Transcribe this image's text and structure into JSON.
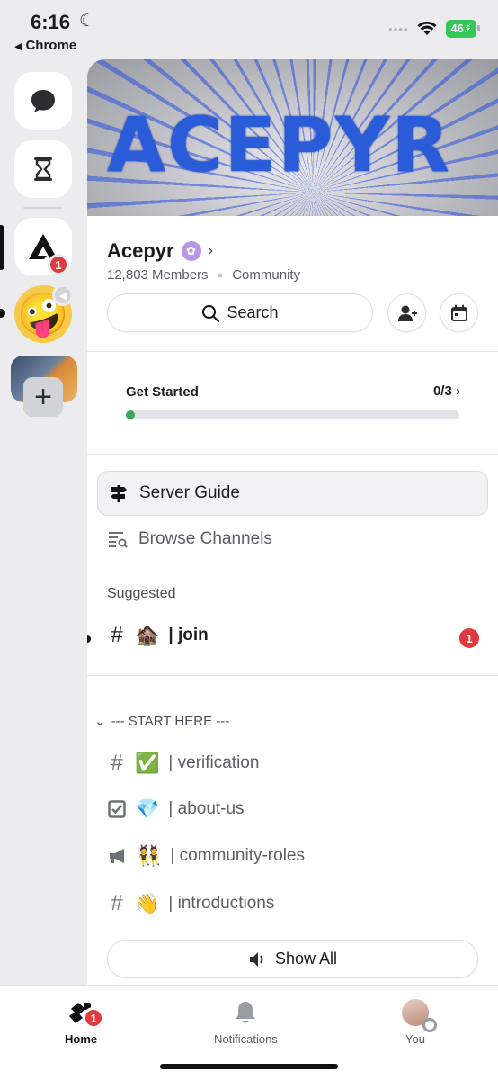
{
  "status": {
    "time": "6:16",
    "back_app": "Chrome",
    "battery": "46"
  },
  "rail": {
    "server_badge": "1"
  },
  "server": {
    "banner_text": "ACEPYR",
    "name": "Acepyr",
    "members": "12,803 Members",
    "type": "Community"
  },
  "actions": {
    "search_label": "Search"
  },
  "get_started": {
    "title": "Get Started",
    "progress": "0/3",
    "progress_fraction": 0
  },
  "nav": {
    "server_guide": "Server Guide",
    "browse_channels": "Browse Channels"
  },
  "suggested": {
    "heading": "Suggested",
    "channel": {
      "emoji": "🏚️",
      "name": "| join",
      "badge": "1"
    }
  },
  "category": {
    "name": "--- START HERE ---",
    "channels": [
      {
        "icon": "hash-icon",
        "emoji": "✅",
        "name": "| verification"
      },
      {
        "icon": "rules-icon",
        "emoji": "💎",
        "name": "| about-us"
      },
      {
        "icon": "announcement-icon",
        "emoji": "👯",
        "name": "| community-roles"
      },
      {
        "icon": "hash-icon",
        "emoji": "👋",
        "name": "| introductions"
      }
    ]
  },
  "show_all": "Show All",
  "tabs": {
    "home": "Home",
    "home_badge": "1",
    "notifications": "Notifications",
    "you": "You"
  },
  "colors": {
    "accent_red": "#e03a3e",
    "progress_green": "#3ba55c",
    "boost_purple": "#b796e8",
    "banner_blue": "#2a5bd8"
  }
}
